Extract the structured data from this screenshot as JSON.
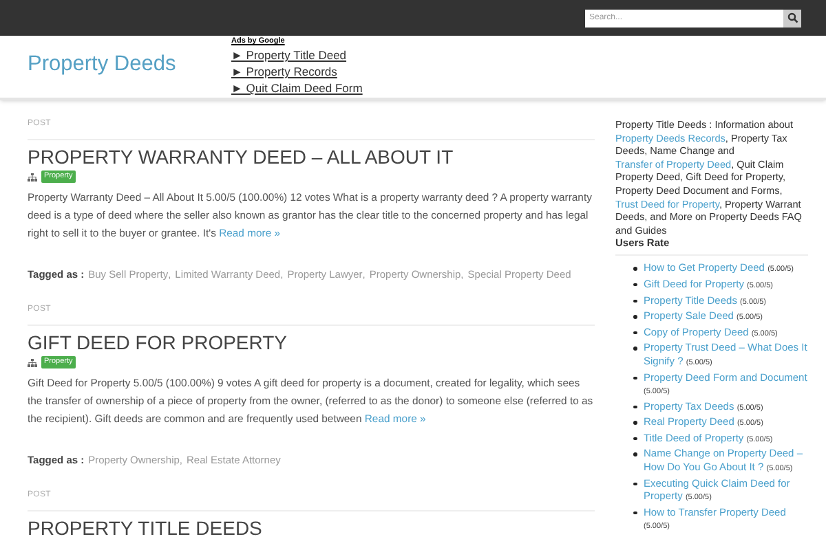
{
  "search": {
    "placeholder": "Search..."
  },
  "site_title": "Property Deeds",
  "ads": {
    "label": "Ads by Google",
    "links": [
      "► Property Title Deed",
      "► Property Records",
      "► Quit Claim Deed Form"
    ]
  },
  "posts": [
    {
      "label": "POST",
      "title": "PROPERTY WARRANTY DEED – ALL ABOUT IT",
      "category": "Property",
      "excerpt": "Property Warranty Deed – All About It 5.00/5 (100.00%) 12 votes What is a property warranty deed ? A property warranty deed is a type of deed where the seller also known as grantor has the clear title to the concerned property and has legal right to sell it to the buyer or grantee. It's",
      "read_more": "Read more »",
      "tags_label": "Tagged as :",
      "tag_separator": ",",
      "tags": [
        "Buy Sell Property",
        "Limited Warranty Deed",
        "Property Lawyer",
        "Property Ownership",
        "Special Property Deed"
      ]
    },
    {
      "label": "POST",
      "title": "GIFT DEED FOR PROPERTY",
      "category": "Property",
      "excerpt": "Gift Deed for Property 5.00/5 (100.00%) 9 votes A gift deed for property is a document, created for legality, which sees the transfer of ownership of a piece of property from the owner, (referred to as the donor) to someone else (referred to as the recipient). Gift deeds are common and are frequently used between",
      "read_more": "Read more »",
      "tags_label": "Tagged as :",
      "tag_separator": ",",
      "tags": [
        "Property Ownership",
        "Real Estate Attorney"
      ]
    },
    {
      "label": "POST",
      "title": "PROPERTY TITLE DEEDS"
    }
  ],
  "sidebar": {
    "intro": [
      {
        "kind": "text",
        "text": "Property Title Deeds : Information about "
      },
      {
        "kind": "link",
        "text": "Property Deeds Records"
      },
      {
        "kind": "text",
        "text": ", Property Tax Deeds, Name Change and "
      },
      {
        "kind": "link",
        "text": "Transfer of Property Deed"
      },
      {
        "kind": "text",
        "text": ", Quit Claim Property Deed, Gift Deed for Property, Property Deed Document and Forms, "
      },
      {
        "kind": "link",
        "text": "Trust Deed for Property"
      },
      {
        "kind": "text",
        "text": ", Property Warrant Deeds, and More on Property Deeds FAQ and Guides"
      }
    ],
    "rate_title": "Users Rate",
    "rated": [
      {
        "title": "How to Get Property Deed",
        "rating": "(5.00/5)"
      },
      {
        "title": "Gift Deed for Property",
        "rating": "(5.00/5)"
      },
      {
        "title": "Property Title Deeds",
        "rating": "(5.00/5)"
      },
      {
        "title": "Property Sale Deed",
        "rating": "(5.00/5)"
      },
      {
        "title": "Copy of Property Deed",
        "rating": "(5.00/5)"
      },
      {
        "title": "Property Trust Deed – What Does It Signify ?",
        "rating": "(5.00/5)"
      },
      {
        "title": "Property Deed Form and Document",
        "rating": "(5.00/5)"
      },
      {
        "title": "Property Tax Deeds",
        "rating": "(5.00/5)"
      },
      {
        "title": "Real Property Deed",
        "rating": "(5.00/5)"
      },
      {
        "title": "Title Deed of Property",
        "rating": "(5.00/5)"
      },
      {
        "title": "Name Change on Property Deed – How Do You Go About It ?",
        "rating": "(5.00/5)"
      },
      {
        "title": "Executing Quick Claim Deed for Property",
        "rating": "(5.00/5)"
      },
      {
        "title": "How to Transfer Property Deed",
        "rating": "(5.00/5)"
      }
    ]
  }
}
